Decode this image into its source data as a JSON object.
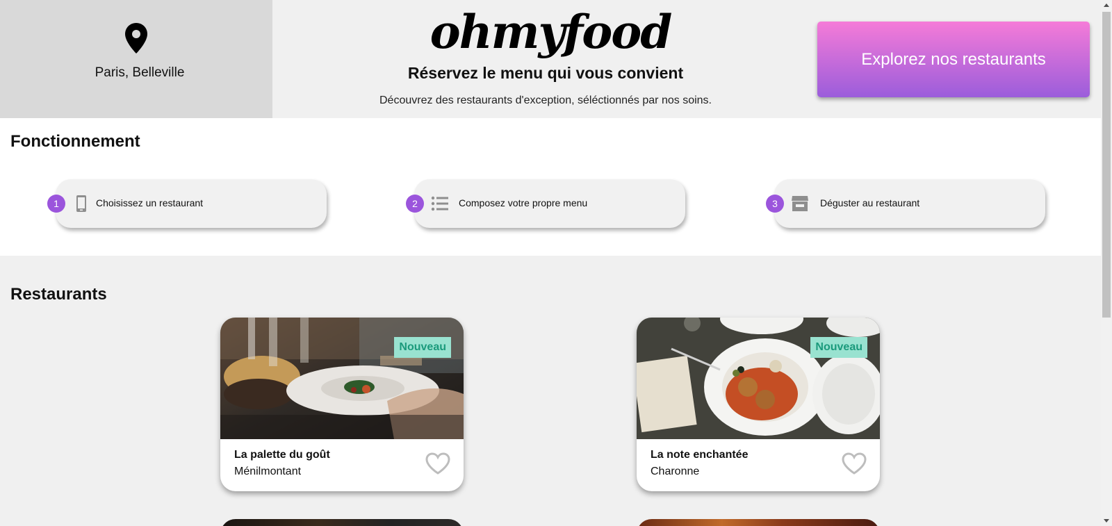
{
  "header": {
    "location": "Paris, Belleville",
    "logo": "ohmyfood",
    "tagline": "Réservez le menu qui vous convient",
    "subline": "Découvrez des restaurants d'exception, séléctionnés par nos soins.",
    "cta_label": "Explorez nos restaurants"
  },
  "how": {
    "title": "Fonctionnement",
    "steps": [
      {
        "num": "1",
        "label": "Choisissez un restaurant",
        "icon": "mobile-phone-icon"
      },
      {
        "num": "2",
        "label": "Composez votre propre menu",
        "icon": "list-icon"
      },
      {
        "num": "3",
        "label": "Déguster au restaurant",
        "icon": "store-icon"
      }
    ]
  },
  "restaurants": {
    "title": "Restaurants",
    "items": [
      {
        "name": "La palette du goût",
        "area": "Ménilmontant",
        "badge": "Nouveau"
      },
      {
        "name": "La note enchantée",
        "area": "Charonne",
        "badge": "Nouveau"
      }
    ]
  },
  "colors": {
    "accent_purple": "#9b55dc",
    "cta_gradient_top": "#f57bd8",
    "cta_gradient_bottom": "#9b5ddb",
    "badge_bg": "#99e2d0",
    "badge_text": "#1b9a7c"
  }
}
